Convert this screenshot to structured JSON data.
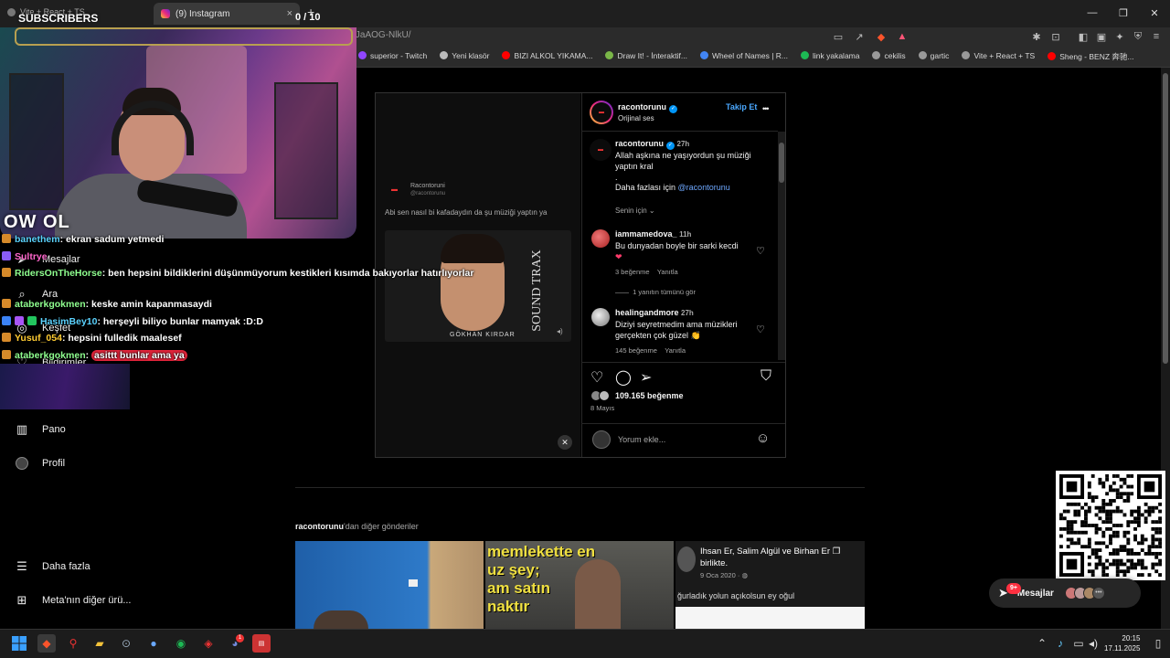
{
  "browser": {
    "inactive_tab_label": "Vite + React + TS",
    "active_tab_label": "(9) Instagram",
    "tab_close": "×",
    "new_tab": "+",
    "url": "instagram.com/p/DJaAOG-NlkU/",
    "window_controls": [
      "—",
      "❐",
      "✕"
    ],
    "bookmarks": [
      {
        "label": "superior - Twitch",
        "color": "#9146ff"
      },
      {
        "label": "Yeni klasör",
        "color": "#bbbbbb"
      },
      {
        "label": "BIZI ALKOL YIKAMA...",
        "color": "#ff0000"
      },
      {
        "label": "Draw It! - İnteraktif...",
        "color": "#7ab648"
      },
      {
        "label": "Wheel of Names | R...",
        "color": "#4285f4"
      },
      {
        "label": "link yakalama",
        "color": "#1db954"
      },
      {
        "label": "cekilis",
        "color": "#999999"
      },
      {
        "label": "gartic",
        "color": "#999999"
      },
      {
        "label": "Vite + React + TS",
        "color": "#999999"
      },
      {
        "label": "Sheng - BENZ 奔驰...",
        "color": "#ff0000"
      }
    ]
  },
  "stream_overlay": {
    "subscribers_label": "SUBSCRIBERS",
    "subscribers_count": "0 / 10",
    "logo_text": "OW OL",
    "chat": [
      {
        "user": "banethem",
        "message": "ekran sadum yetmedi",
        "user_color": "#5bd3ff"
      },
      {
        "user": "Sultrye",
        "message": "",
        "user_color": "#ff66cc"
      },
      {
        "user": "RidersOnTheHorse",
        "message": "ben hepsini bildiklerini düşünmüyorum kestikleri kısımda bakıyorlar hatırlıyorlar",
        "user_color": "#8fff8f"
      },
      {
        "user": "ataberkgokmen",
        "message": "keske amin kapanmasaydi",
        "user_color": "#8fff8f"
      },
      {
        "user": "HasimBey10",
        "message": "herşeyli biliyo bunlar mamyak :D:D",
        "user_color": "#5bd3ff"
      },
      {
        "user": "Yusuf_054",
        "message": "hepsini fulledik maalesef",
        "user_color": "#ffcc33"
      },
      {
        "user": "ataberkgokmen",
        "message": "asittt bunlar ama ya",
        "user_color": "#8fff8f"
      }
    ]
  },
  "sidebar": {
    "items": [
      {
        "label": "Mesajlar",
        "icon": "send-icon"
      },
      {
        "label": "Ara",
        "icon": "search-icon"
      },
      {
        "label": "Keşfet",
        "icon": "compass-icon"
      },
      {
        "label": "Bildirimler",
        "icon": "heart-icon"
      },
      {
        "label": "Pano",
        "icon": "chart-icon"
      },
      {
        "label": "Profil",
        "icon": "profile-avatar"
      },
      {
        "label": "Daha fazla",
        "icon": "menu-icon"
      },
      {
        "label": "Meta'nın diğer ürü...",
        "icon": "grid-icon"
      }
    ]
  },
  "post": {
    "media": {
      "account": "Racontoruni",
      "handle": "@racontorunu",
      "caption": "Abi sen nasıl bi kafadaydın da şu müziği yaptın ya",
      "album_text": "SOUND TRAX",
      "artist": "GÖKHAN KIRDAR"
    },
    "header": {
      "username": "racontorunu",
      "subtitle": "Orijinal ses",
      "follow_label": "Takip Et",
      "more_label": "•••"
    },
    "caption": {
      "username": "racontorunu",
      "time": "27h",
      "text_line1": "Allah aşkına ne yaşıyordun şu müziği",
      "text_line2": "yaptın kral",
      "dot": ".",
      "more_prefix": "Daha fazlası için ",
      "more_mention": "@racontorunu",
      "for_you": "Senin için"
    },
    "comments": [
      {
        "username": "iammamedova_",
        "time": "11h",
        "text_line1": "Bu dunyadan boyle bir sarki kecdi",
        "text_line2": "❤",
        "likes": "3 beğenme",
        "reply": "Yanıtla",
        "view_replies": "1 yanıtın tümünü gör",
        "avatar_color": "#d44"
      },
      {
        "username": "healingandmore",
        "time": "27h",
        "text_line1": "Diziyi seyretmedim ama müzikleri",
        "text_line2": "gerçekten çok güzel 👏",
        "likes": "145 beğenme",
        "reply": "Yanıtla",
        "avatar_color": "#bbb"
      }
    ],
    "likes": "109.165 beğenme",
    "date": "8 Mayıs",
    "comment_placeholder": "Yorum ekle...",
    "emoji_icon": "☺"
  },
  "more_posts": {
    "owner": "racontorunu",
    "suffix": "'dan diğer gönderiler",
    "tile2_text_line1": "memlekette en",
    "tile2_text_line2": "uz şey;",
    "tile2_text_line3": "am satın",
    "tile2_text_line4": "naktır",
    "tile3_authors_a": "Ihsan Er, Salim Algül",
    "tile3_authors_and": " ve ",
    "tile3_authors_b": "Birhan Er",
    "tile3_with": "birlikte.",
    "tile3_date": "9 Oca 2020 · ",
    "tile3_caption": "ğurladık yolun açıkolsun ey oğul"
  },
  "messages": {
    "label": "Mesajlar",
    "badge": "9+"
  },
  "taskbar": {
    "time": "20:15",
    "date": "17.11.2025",
    "discord_badge": "1"
  }
}
